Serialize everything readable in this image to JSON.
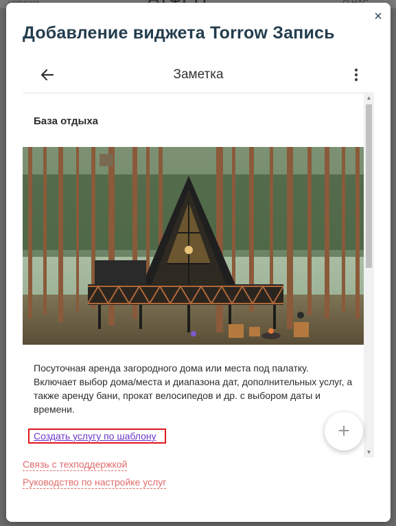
{
  "background": {
    "left_text": "новинки",
    "center_text": "АТФЕН",
    "right_text": "О НАС"
  },
  "modal": {
    "title": "Добавление виджета Torrow Запись",
    "close_label": "×"
  },
  "panel": {
    "header_title": "Заметка",
    "section_title": "База отдыха",
    "photo_icon": "a-frame-cabin-in-pine-forest",
    "description": "Посуточная аренда загородного дома или места под палатку. Включает выбор дома/места и диапазона дат, дополнительных услуг, а также аренду бани, прокат велосипедов и др. с выбором даты и времени.",
    "template_link": "Создать услугу по шаблону",
    "fab_label": "+"
  },
  "footer": {
    "support_link": "Связь с техподдержкой",
    "guide_link": "Руководство по настройке услуг"
  },
  "colors": {
    "title": "#243d4d",
    "link_purple": "#6a35c9",
    "footer_link": "#e06a6a",
    "highlight_border": "#e0141e"
  }
}
